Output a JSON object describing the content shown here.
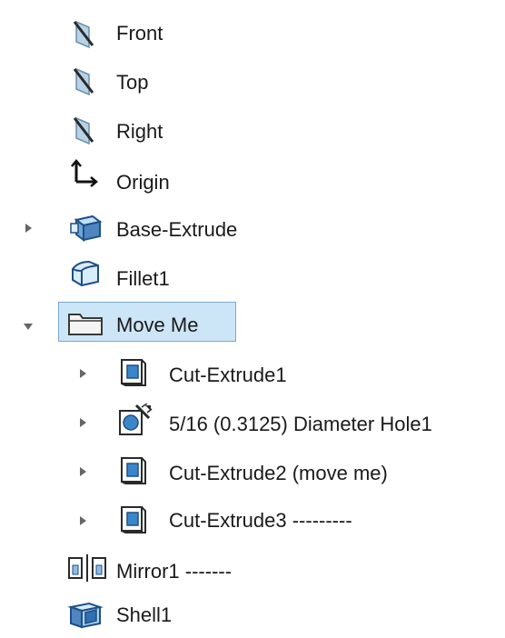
{
  "feature_tree": {
    "items": [
      {
        "label": "Front",
        "icon": "plane-icon",
        "level": 0,
        "expander": "none"
      },
      {
        "label": "Top",
        "icon": "plane-icon",
        "level": 0,
        "expander": "none"
      },
      {
        "label": "Right",
        "icon": "plane-icon",
        "level": 0,
        "expander": "none"
      },
      {
        "label": "Origin",
        "icon": "origin-icon",
        "level": 0,
        "expander": "none"
      },
      {
        "label": "Base-Extrude",
        "icon": "extrude-icon",
        "level": 0,
        "expander": "collapsed"
      },
      {
        "label": "Fillet1",
        "icon": "fillet-icon",
        "level": 0,
        "expander": "none"
      },
      {
        "label": "Move Me",
        "icon": "folder-icon",
        "level": 0,
        "expander": "expanded",
        "selected": true
      },
      {
        "label": "Cut-Extrude1",
        "icon": "cut-extrude-icon",
        "level": 1,
        "expander": "collapsed"
      },
      {
        "label": "5/16 (0.3125) Diameter Hole1",
        "icon": "hole-wizard-icon",
        "level": 1,
        "expander": "collapsed"
      },
      {
        "label": "Cut-Extrude2 (move me)",
        "icon": "cut-extrude-icon",
        "level": 1,
        "expander": "collapsed"
      },
      {
        "label": "Cut-Extrude3 ---------",
        "icon": "cut-extrude-icon",
        "level": 1,
        "expander": "collapsed"
      },
      {
        "label": "Mirror1 -------",
        "icon": "mirror-icon",
        "level": 0,
        "expander": "none"
      },
      {
        "label": "Shell1",
        "icon": "shell-icon",
        "level": 0,
        "expander": "none"
      }
    ]
  },
  "colors": {
    "selection_fill": "#cde6f7",
    "selection_border": "#7aa7d2"
  }
}
